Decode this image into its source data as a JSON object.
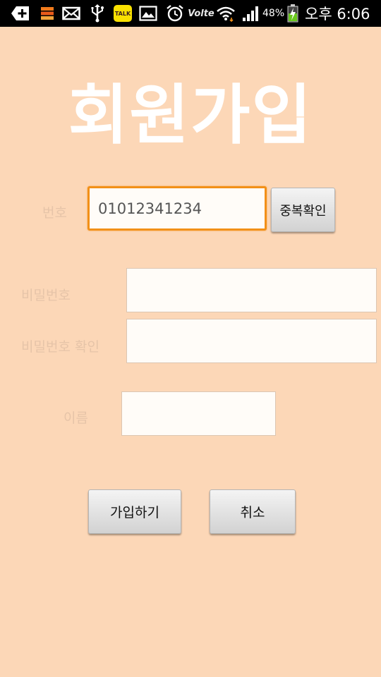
{
  "status_bar": {
    "icons": {
      "add": "add-box-icon",
      "app": "app-stack-icon",
      "mail": "mail-icon",
      "usb": "usb-icon",
      "talk": "kakaotalk-icon",
      "talk_label": "TALK",
      "gallery": "gallery-icon",
      "alarm": "alarm-icon",
      "volte": "volte-icon",
      "volte_label": "Volte",
      "wifi": "wifi-icon",
      "signal": "signal-icon",
      "battery": "battery-charging-icon"
    },
    "battery_percent": "48%",
    "time": "오후 6:06"
  },
  "title": "회원가입",
  "form": {
    "phone": {
      "label": "번호",
      "value": "01012341234",
      "check_button": "중복확인"
    },
    "password": {
      "label": "비밀번호",
      "value": ""
    },
    "password_confirm": {
      "label": "비밀번호 확인",
      "value": ""
    },
    "name": {
      "label": "이름",
      "value": ""
    }
  },
  "actions": {
    "signup": "가입하기",
    "cancel": "취소"
  },
  "colors": {
    "background": "#fcd7b7",
    "title": "#ffffff",
    "label": "#e6c4a8",
    "focus_border": "#f29018",
    "status_bar": "#000000"
  }
}
